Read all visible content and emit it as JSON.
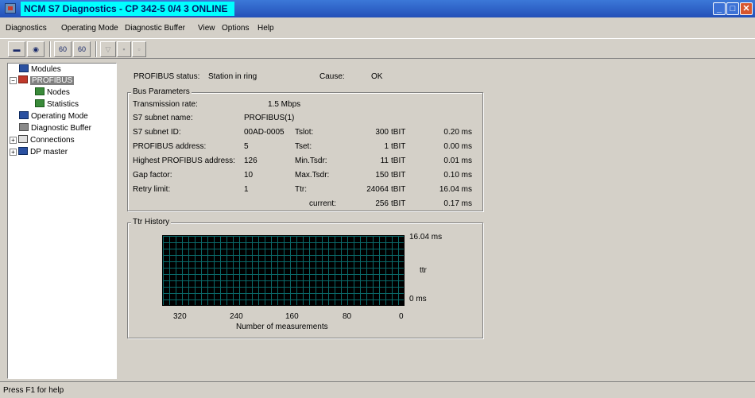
{
  "window": {
    "title": "NCM S7 Diagnostics - CP 342-5 0/4 3  ONLINE",
    "min_icon": "minimize-icon",
    "max_icon": "maximize-icon",
    "close_icon": "close-icon"
  },
  "menu": [
    "Diagnostics",
    "Operating Mode",
    "Diagnostic Buffer",
    "View",
    "Options",
    "Help"
  ],
  "toolbar": {
    "buttons": [
      {
        "label": "▬",
        "icon": "connect-icon"
      },
      {
        "label": "◉",
        "icon": "stop-icon"
      },
      {
        "label": "60",
        "icon": "update-icon"
      },
      {
        "label": "60",
        "icon": "auto-update-icon"
      },
      {
        "label": "▽",
        "icon": "filter-icon"
      },
      {
        "label": "▪",
        "icon": "unknown-icon"
      },
      {
        "label": "▫",
        "icon": "print-icon"
      }
    ]
  },
  "tree": [
    {
      "label": "Modules",
      "icon": "modules-icon"
    },
    {
      "label": "PROFIBUS",
      "icon": "profibus-icon",
      "expander": "−"
    },
    {
      "label": "Nodes",
      "icon": "nodes-icon"
    },
    {
      "label": "Statistics",
      "icon": "statistics-icon"
    },
    {
      "label": "Operating Mode",
      "icon": "operating-mode-icon"
    },
    {
      "label": "Diagnostic Buffer",
      "icon": "diagnostic-buffer-icon"
    },
    {
      "label": "Connections",
      "icon": "connections-icon",
      "expander": "+"
    },
    {
      "label": "DP master",
      "icon": "dp-master-icon",
      "expander": "+"
    }
  ],
  "status": {
    "profibus_status_label": "PROFIBUS status:",
    "profibus_status_value": "Station in ring",
    "cause_label": "Cause:",
    "cause_value": "OK"
  },
  "bus_parameters": {
    "title": "Bus Parameters",
    "rows": [
      {
        "label": "Transmission rate:",
        "value": "1.5 Mbps"
      },
      {
        "label": "S7 subnet name:",
        "value": "PROFIBUS(1)"
      },
      {
        "label": "S7 subnet ID:",
        "value": "00AD-0005"
      },
      {
        "label": "PROFIBUS address:",
        "value": "5"
      },
      {
        "label": "Highest PROFIBUS address:",
        "value": "126"
      },
      {
        "label": "Gap factor:",
        "value": "10"
      },
      {
        "label": "Retry limit:",
        "value": "1"
      }
    ],
    "timings": [
      {
        "label": "Tslot:",
        "bits": "300",
        "unit": "tBIT",
        "ms": "0.20 ms"
      },
      {
        "label": "Tset:",
        "bits": "1",
        "unit": "tBIT",
        "ms": "0.00 ms"
      },
      {
        "label": "Min.Tsdr:",
        "bits": "11",
        "unit": "tBIT",
        "ms": "0.01 ms"
      },
      {
        "label": "Max.Tsdr:",
        "bits": "150",
        "unit": "tBIT",
        "ms": "0.10 ms"
      },
      {
        "label": "Ttr:",
        "bits": "24064",
        "unit": "tBIT",
        "ms": "16.04 ms"
      },
      {
        "label": "current:",
        "bits": "256",
        "unit": "tBIT",
        "ms": "0.17 ms"
      }
    ]
  },
  "ttr_history": {
    "title": "Ttr History",
    "y_max_label": "16.04 ms",
    "y_axis_label": "ttr",
    "y_min_label": "0 ms",
    "x_ticks": [
      "320",
      "240",
      "160",
      "80",
      "0"
    ],
    "x_axis_label": "Number of measurements"
  },
  "statusbar": {
    "text": "Press F1 for help"
  }
}
